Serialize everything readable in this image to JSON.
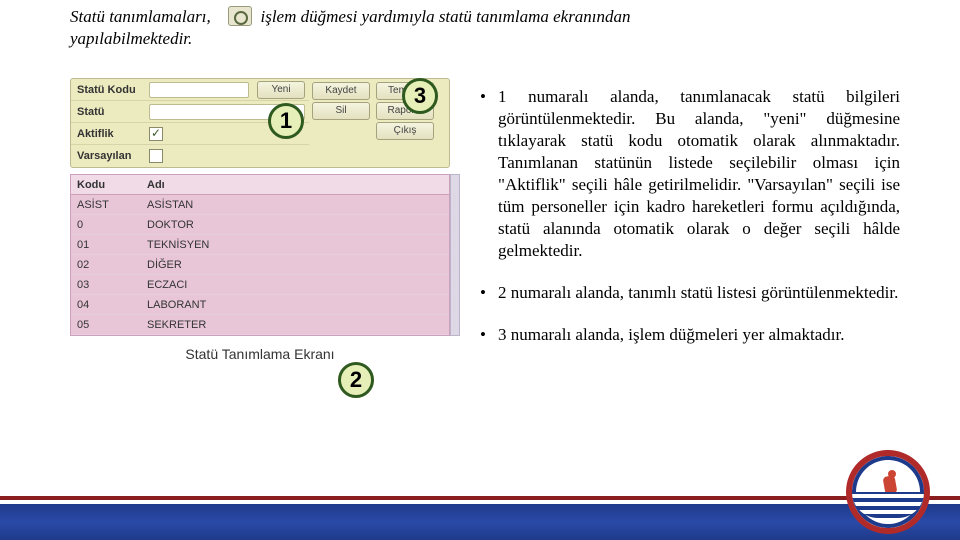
{
  "intro": {
    "left": "Statü tanımlamaları, yapılabilmektedir.",
    "right": "işlem düğmesi yardımıyla statü tanımlama ekranından"
  },
  "screenshot": {
    "form": {
      "labels": {
        "statuKodu": "Statü Kodu",
        "statu": "Statü",
        "aktiflik": "Aktiflik",
        "varsayilan": "Varsayılan"
      },
      "aktiflik_checked": true,
      "varsayilan_checked": false,
      "yeni_button": "Yeni"
    },
    "action_buttons_col1": [
      "Kaydet",
      "Sil",
      ""
    ],
    "action_buttons_col2": [
      "Temizle",
      "Raporla",
      "Çıkış"
    ],
    "markers": {
      "one": "1",
      "two": "2",
      "three": "3"
    },
    "list": {
      "headers": {
        "kodu": "Kodu",
        "adi": "Adı"
      },
      "rows": [
        {
          "kodu": "ASİST",
          "adi": "ASİSTAN"
        },
        {
          "kodu": "0",
          "adi": "DOKTOR"
        },
        {
          "kodu": "01",
          "adi": "TEKNİSYEN"
        },
        {
          "kodu": "02",
          "adi": "DİĞER"
        },
        {
          "kodu": "03",
          "adi": "ECZACI"
        },
        {
          "kodu": "04",
          "adi": "LABORANT"
        },
        {
          "kodu": "05",
          "adi": "SEKRETER"
        }
      ]
    },
    "caption": "Statü Tanımlama Ekranı"
  },
  "bullets": [
    "1 numaralı alanda, tanımlanacak statü bilgileri görüntülenmektedir. Bu alanda, \"yeni\" düğmesine tıklayarak statü kodu otomatik olarak alınmaktadır. Tanımlanan statünün listede seçilebilir olması için \"Aktiflik\" seçili hâle getirilmelidir. \"Varsayılan\" seçili ise tüm personeller için kadro hareketleri formu açıldığında, statü alanında otomatik olarak o değer seçili hâlde gelmektedir.",
    "2 numaralı alanda, tanımlı statü listesi görüntülenmektedir.",
    "3 numaralı alanda, işlem düğmeleri yer almaktadır."
  ]
}
